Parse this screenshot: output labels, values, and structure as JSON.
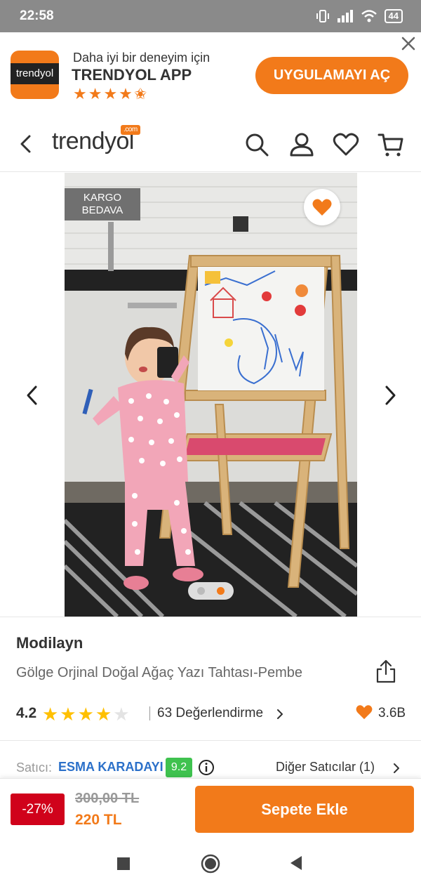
{
  "status_bar": {
    "time": "22:58",
    "battery": "44"
  },
  "app_banner": {
    "subtitle": "Daha iyi bir deneyim için",
    "title": "TRENDYOL APP",
    "stars": "★★★★",
    "logo_text": "trendyol",
    "open_button": "UYGULAMAYI AÇ"
  },
  "nav": {
    "logo": "trendyol",
    "logo_com": ".com"
  },
  "gallery": {
    "badge_line1": "KARGO",
    "badge_line2": "BEDAVA",
    "active_dot": 2,
    "total_dots": 2
  },
  "product": {
    "brand": "Modilayn",
    "name": "Gölge Orjinal Doğal Ağaç Yazı Tahtası-Pembe",
    "rating": "4.2",
    "reviews": "63  Değerlendirme",
    "likes": "3.6B"
  },
  "seller": {
    "label": "Satıcı:",
    "name": "ESMA KARADAYI",
    "score": "9.2",
    "other_sellers": "Diğer Satıcılar (1)"
  },
  "pricing": {
    "discount": "-27%",
    "old_price": "300,00 TL",
    "new_price": "220 TL",
    "add_to_cart": "Sepete Ekle"
  },
  "colors": {
    "brand_orange": "#f27a1a",
    "discount_red": "#d0021b",
    "seller_blue": "#2b70c9",
    "score_green": "#3fc24f"
  }
}
